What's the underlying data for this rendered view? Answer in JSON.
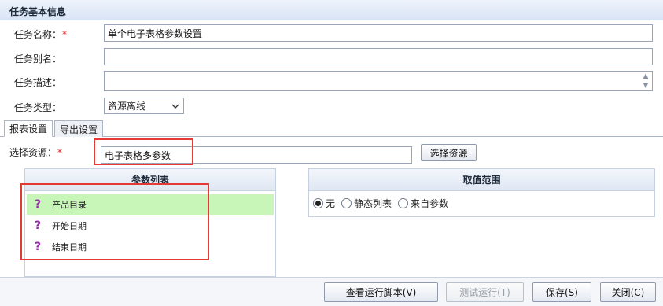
{
  "section": {
    "title": "任务基本信息"
  },
  "form": {
    "name": {
      "label": "任务名称：",
      "required_mark": "*",
      "value": "单个电子表格参数设置"
    },
    "alias": {
      "label": "任务别名：",
      "value": ""
    },
    "description": {
      "label": "任务描述：",
      "value": ""
    },
    "type": {
      "label": "任务类型：",
      "value": "资源离线"
    }
  },
  "tabs": [
    {
      "label": "报表设置",
      "active": true
    },
    {
      "label": "导出设置",
      "active": false
    }
  ],
  "resource": {
    "label": "选择资源：",
    "required_mark": "*",
    "value": "电子表格多参数",
    "button": "选择资源"
  },
  "param_panel": {
    "title": "参数列表",
    "items": [
      {
        "icon": "question-icon",
        "label": "产品目录",
        "selected": true
      },
      {
        "icon": "question-icon",
        "label": "开始日期",
        "selected": false
      },
      {
        "icon": "question-icon",
        "label": "结束日期",
        "selected": false
      }
    ]
  },
  "range_panel": {
    "title": "取值范围",
    "options": [
      {
        "label": "无",
        "checked": true
      },
      {
        "label": "静态列表",
        "checked": false
      },
      {
        "label": "来自参数",
        "checked": false
      }
    ]
  },
  "buttons": {
    "view_script": "查看运行脚本(V)",
    "test_run": "测试运行(T)",
    "save": "保存(S)",
    "close": "关闭(C)"
  },
  "colors": {
    "highlight": "#e53935",
    "selected_row": "#c8f5b8",
    "required": "#e02020",
    "param_icon": "#9c27b0"
  }
}
